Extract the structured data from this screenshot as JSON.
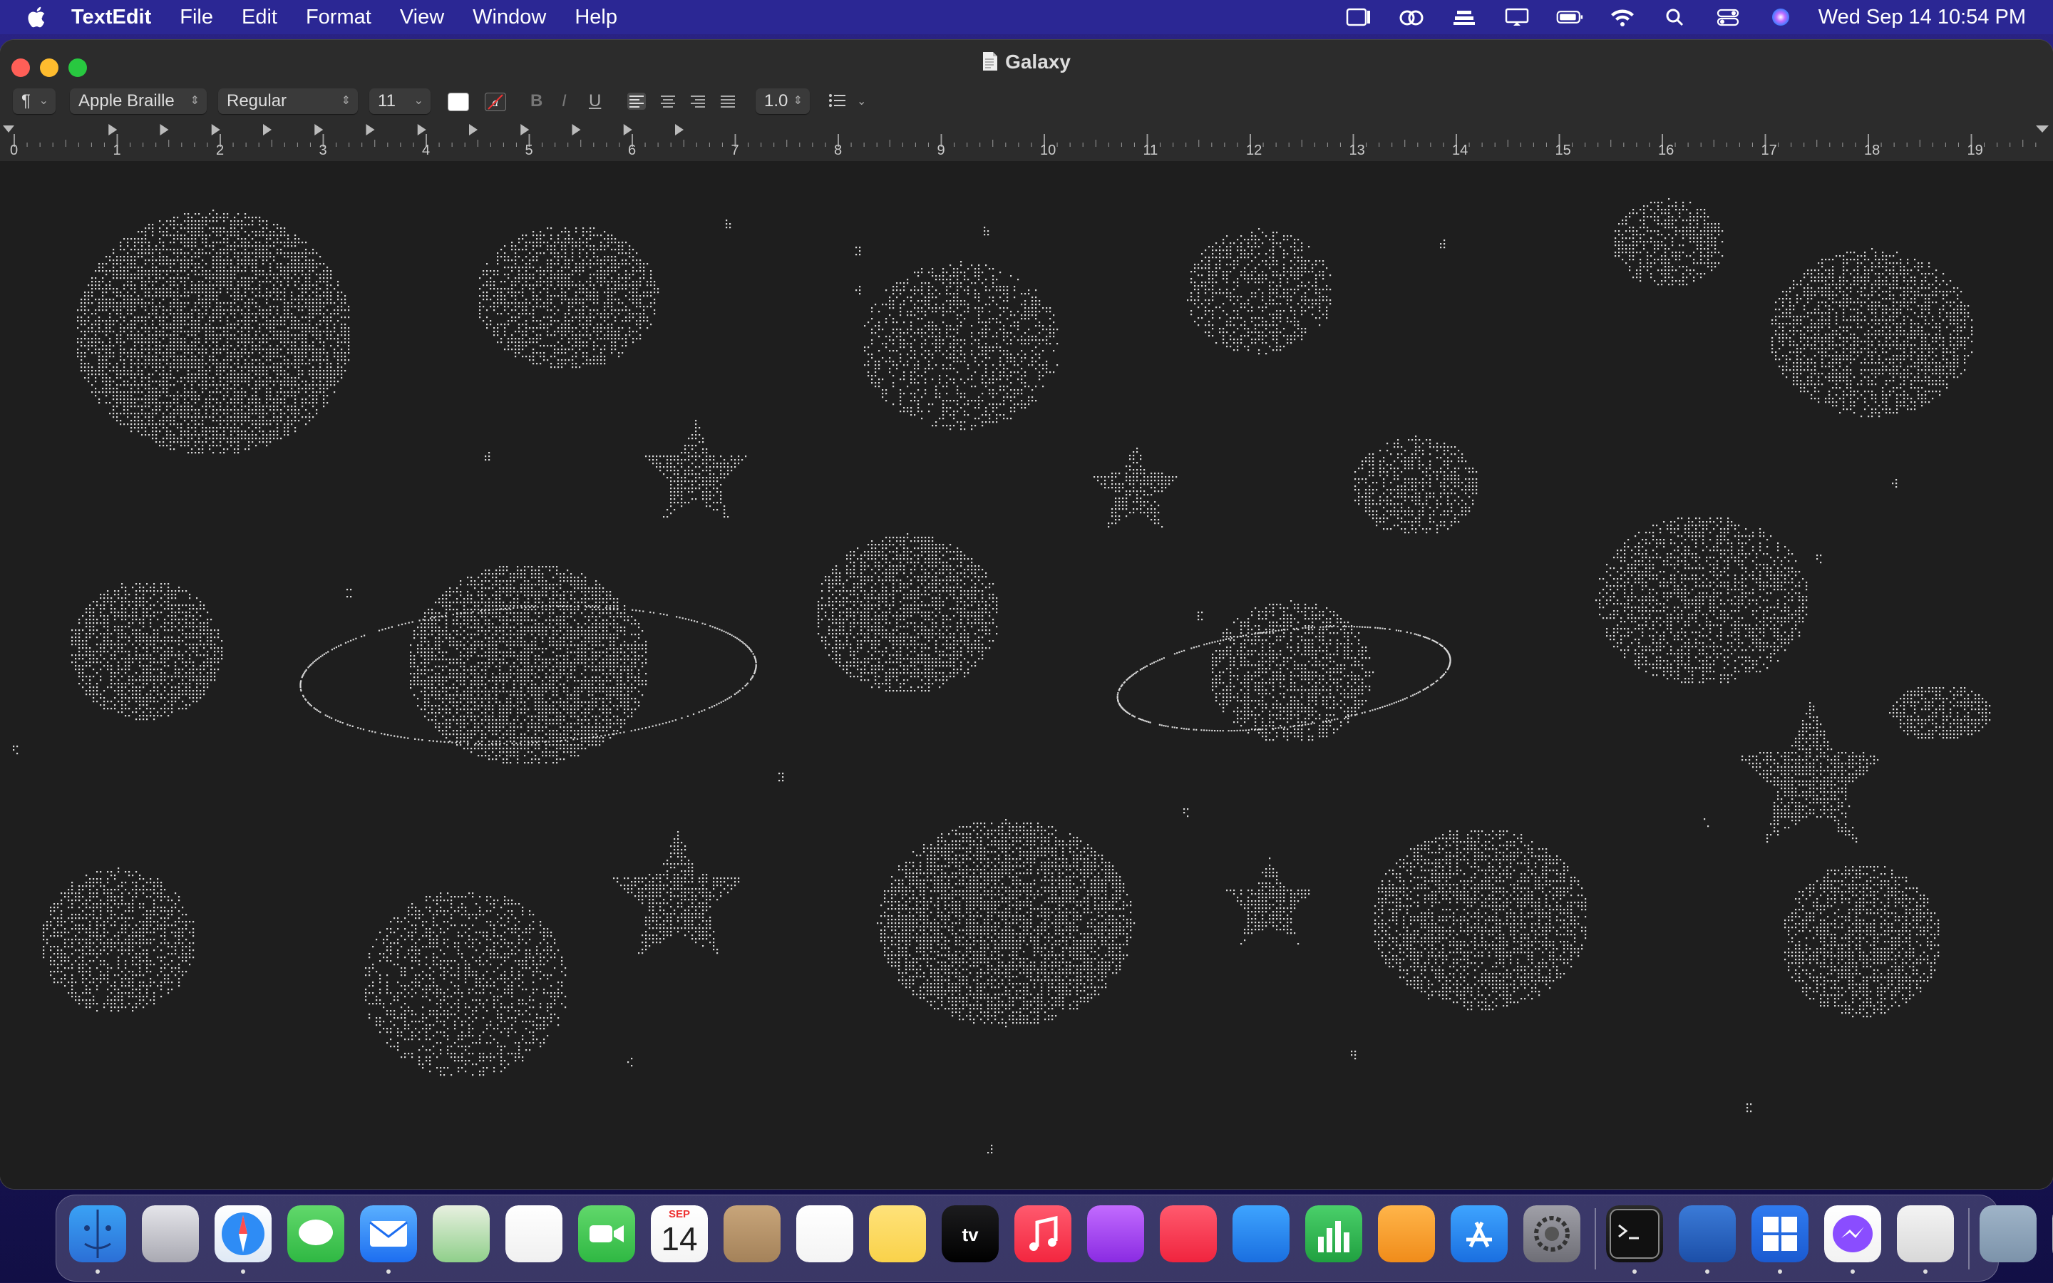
{
  "menubar": {
    "app_name": "TextEdit",
    "items": [
      "File",
      "Edit",
      "Format",
      "View",
      "Window",
      "Help"
    ],
    "clock": "Wed Sep 14  10:54 PM",
    "status_icons": [
      "stage-manager-icon",
      "creative-cloud-icon",
      "cloud-icon",
      "display-icon",
      "battery-icon",
      "wifi-icon",
      "search-icon",
      "control-center-icon",
      "siri-icon"
    ]
  },
  "window": {
    "title": "Galaxy",
    "toolbar": {
      "paragraph_style": "¶",
      "font_family": "Apple Braille",
      "font_style": "Regular",
      "font_size": "11",
      "bold": "B",
      "italic": "I",
      "underline": "U",
      "line_spacing": "1.0"
    },
    "ruler": {
      "numbers": [
        "0",
        "1",
        "2",
        "3",
        "4",
        "5",
        "6",
        "7",
        "8",
        "9",
        "10",
        "11",
        "12",
        "13",
        "14",
        "15",
        "16",
        "17",
        "18",
        "19"
      ]
    },
    "document": {
      "content": "braille-dot galaxy art: planets, stars and ringed planets"
    }
  },
  "dock": {
    "apps": [
      "Finder",
      "Launchpad",
      "Safari",
      "Messages",
      "Mail",
      "Maps",
      "Photos",
      "FaceTime",
      "Calendar",
      "Contacts",
      "Reminders",
      "Notes",
      "TV",
      "Music",
      "Podcasts",
      "News",
      "Keynote",
      "Numbers",
      "Pages",
      "App Store",
      "System Preferences",
      "Terminal",
      "Screen Sharing",
      "Windows App",
      "Messenger",
      "TextEdit",
      "Downloads",
      "Trash"
    ],
    "calendar": {
      "month": "SEP",
      "day": "14"
    }
  }
}
